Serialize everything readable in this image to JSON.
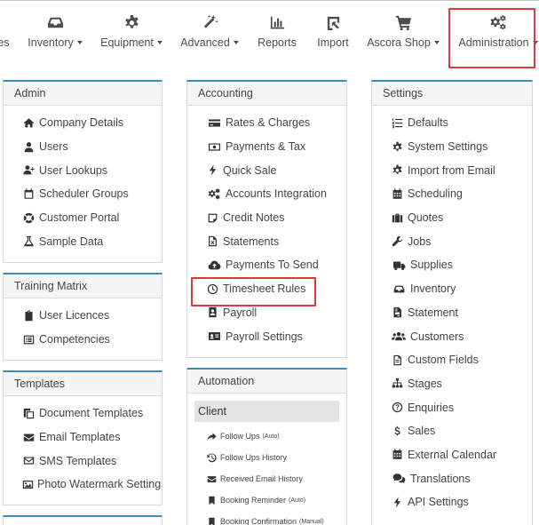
{
  "nav": [
    {
      "label": "es",
      "icon": "none",
      "dropdown": false
    },
    {
      "label": "Inventory",
      "icon": "inbox-icon",
      "dropdown": true
    },
    {
      "label": "Equipment",
      "icon": "gear-icon",
      "dropdown": true
    },
    {
      "label": "Advanced",
      "icon": "magic-wand-icon",
      "dropdown": true
    },
    {
      "label": "Reports",
      "icon": "bar-chart-icon",
      "dropdown": false
    },
    {
      "label": "Import",
      "icon": "import-icon",
      "dropdown": false
    },
    {
      "label": "Ascora Shop",
      "icon": "cart-icon",
      "dropdown": true
    },
    {
      "label": "Administration",
      "icon": "gears-icon",
      "dropdown": true
    }
  ],
  "panels": {
    "admin": {
      "title": "Admin",
      "items": [
        "Company Details",
        "Users",
        "User Lookups",
        "Scheduler Groups",
        "Customer Portal",
        "Sample Data"
      ]
    },
    "training": {
      "title": "Training Matrix",
      "items": [
        "User Licences",
        "Competencies"
      ]
    },
    "templates": {
      "title": "Templates",
      "items": [
        "Document Templates",
        "Email Templates",
        "SMS Templates",
        "Photo Watermark Settings"
      ]
    },
    "accounting": {
      "title": "Accounting",
      "items": [
        "Rates & Charges",
        "Payments & Tax",
        "Quick Sale",
        "Accounts Integration",
        "Credit Notes",
        "Statements",
        "Payments To Send",
        "Timesheet Rules",
        "Payroll",
        "Payroll Settings"
      ]
    },
    "automation": {
      "title": "Automation",
      "group": "Client",
      "items": [
        {
          "label": "Follow Ups",
          "suffix": "(Auto)"
        },
        {
          "label": "Follow Ups History",
          "suffix": ""
        },
        {
          "label": "Received Email History",
          "suffix": ""
        },
        {
          "label": "Booking Reminder",
          "suffix": "(Auto)"
        },
        {
          "label": "Booking Confirmation",
          "suffix": "(Manual)"
        }
      ]
    },
    "settings": {
      "title": "Settings",
      "items": [
        "Defaults",
        "System Settings",
        "Import from Email",
        "Scheduling",
        "Quotes",
        "Jobs",
        "Supplies",
        "Inventory",
        "Statement",
        "Customers",
        "Custom Fields",
        "Stages",
        "Enquiries",
        "Sales",
        "External Calendar",
        "Translations",
        "API Settings"
      ]
    }
  },
  "colors": {
    "panel_accent": "#3c8dbc",
    "highlight": "#e0393e",
    "text": "#444444"
  }
}
